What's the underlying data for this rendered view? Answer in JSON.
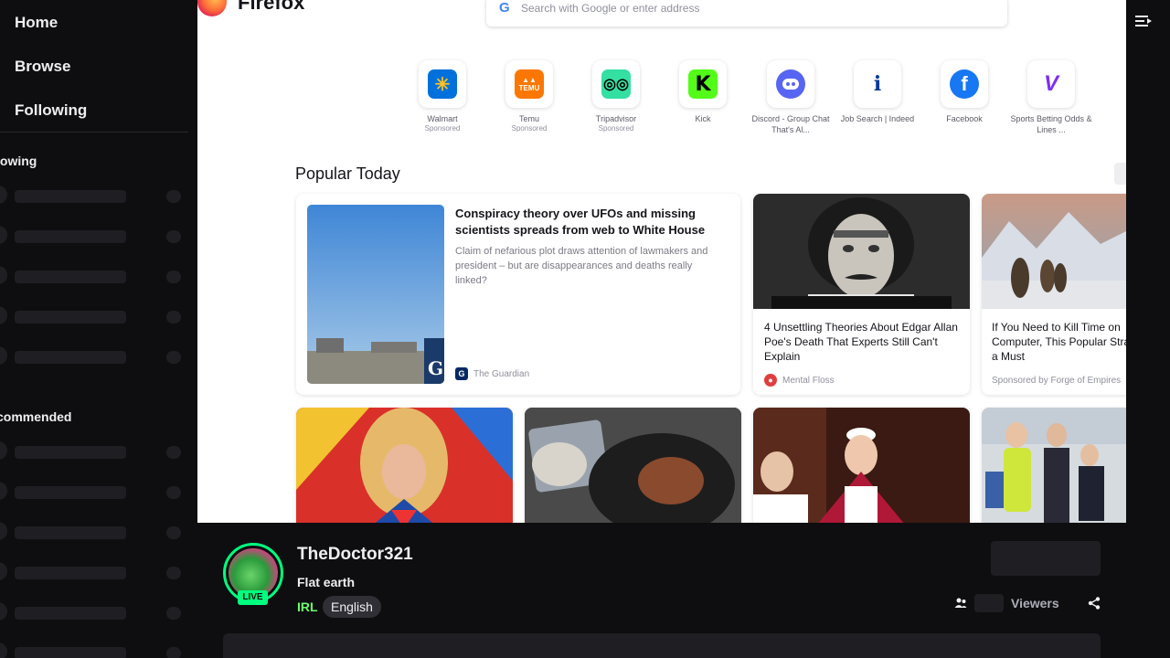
{
  "sidebar": {
    "nav": [
      {
        "label": "Home"
      },
      {
        "label": "Browse"
      },
      {
        "label": "Following"
      }
    ],
    "sections": [
      {
        "title": "lowing"
      },
      {
        "title": "commended"
      }
    ]
  },
  "browser": {
    "brand": "Firefox",
    "search_placeholder": "Search with Google or enter address",
    "google_icon": "G",
    "shortcuts": [
      {
        "label": "Walmart",
        "sub": "Sponsored",
        "icon": "walmart-icon",
        "color": "#0071dc",
        "glyph": "✳"
      },
      {
        "label": "Temu",
        "sub": "Sponsored",
        "icon": "temu-icon",
        "color": "#fb7701",
        "glyph": "T"
      },
      {
        "label": "Tripadvisor",
        "sub": "Sponsored",
        "icon": "tripadvisor-icon",
        "color": "#34e0a1",
        "glyph": "◎"
      },
      {
        "label": "Kick",
        "sub": "",
        "icon": "kick-icon",
        "color": "#53fc18",
        "glyph": "K"
      },
      {
        "label": "Discord - Group Chat That's Al...",
        "sub": "",
        "icon": "discord-icon",
        "color": "#5865f2",
        "glyph": "●"
      },
      {
        "label": "Job Search | Indeed",
        "sub": "",
        "icon": "indeed-icon",
        "color": "#ffffff",
        "glyph": "i"
      },
      {
        "label": "Facebook",
        "sub": "",
        "icon": "facebook-icon",
        "color": "#1877f2",
        "glyph": "f"
      },
      {
        "label": "Sports Betting Odds & Lines ...",
        "sub": "",
        "icon": "sportsbook-icon",
        "color": "#7b2ff7",
        "glyph": "V"
      }
    ],
    "popular_title": "Popular Today",
    "stories": [
      {
        "headline": "Conspiracy theory over UFOs and missing scientists spreads from web to White House",
        "desc": "Claim of nefarious plot draws attention of lawmakers and president – but are disappearances and deaths really linked?",
        "source": "The Guardian"
      },
      {
        "headline": "4 Unsettling Theories About Edgar Allan Poe's Death That Experts Still Can't Explain",
        "source": "Mental Floss"
      },
      {
        "headline": "If You Need to Kill Time on Computer, This Popular Stra Is a Must",
        "source": "Sponsored by Forge of Empires"
      }
    ]
  },
  "channel": {
    "name": "TheDoctor321",
    "title": "Flat earth",
    "category": "IRL",
    "tag": "English",
    "live_label": "LIVE",
    "viewers_label": "Viewers"
  }
}
